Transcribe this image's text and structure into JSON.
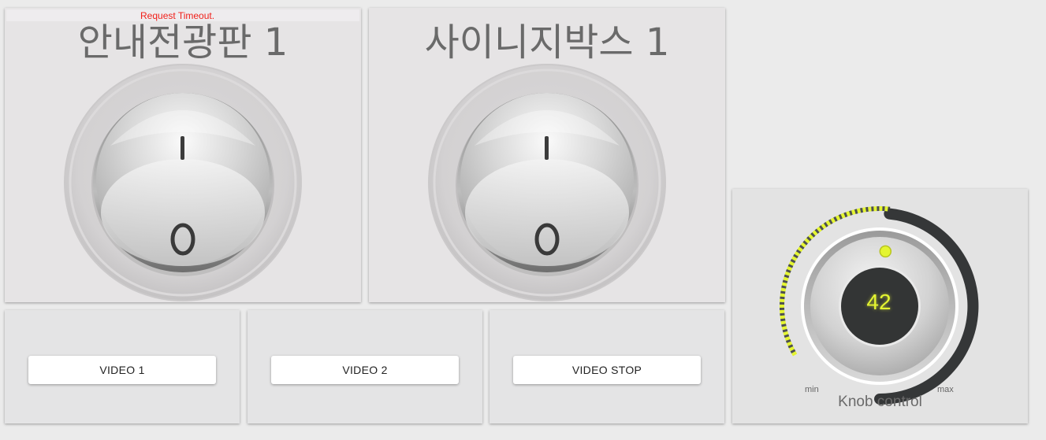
{
  "error": {
    "message": "Request Timeout."
  },
  "switches": [
    {
      "title": "안내전광판 1",
      "on_label": "I",
      "off_label": "0"
    },
    {
      "title": "사이니지박스 1",
      "on_label": "I",
      "off_label": "0"
    }
  ],
  "video_buttons": [
    {
      "label": "VIDEO 1"
    },
    {
      "label": "VIDEO 2"
    },
    {
      "label": "VIDEO STOP"
    }
  ],
  "knob": {
    "value": "42",
    "value_fraction": 0.42,
    "min_label": "min",
    "max_label": "max",
    "label": "Knob control",
    "accent_color": "#e4f531",
    "track_color": "#353738"
  },
  "colors": {
    "background": "#ebebeb",
    "card": "#e4e4e5",
    "error_text": "#f0201a"
  }
}
